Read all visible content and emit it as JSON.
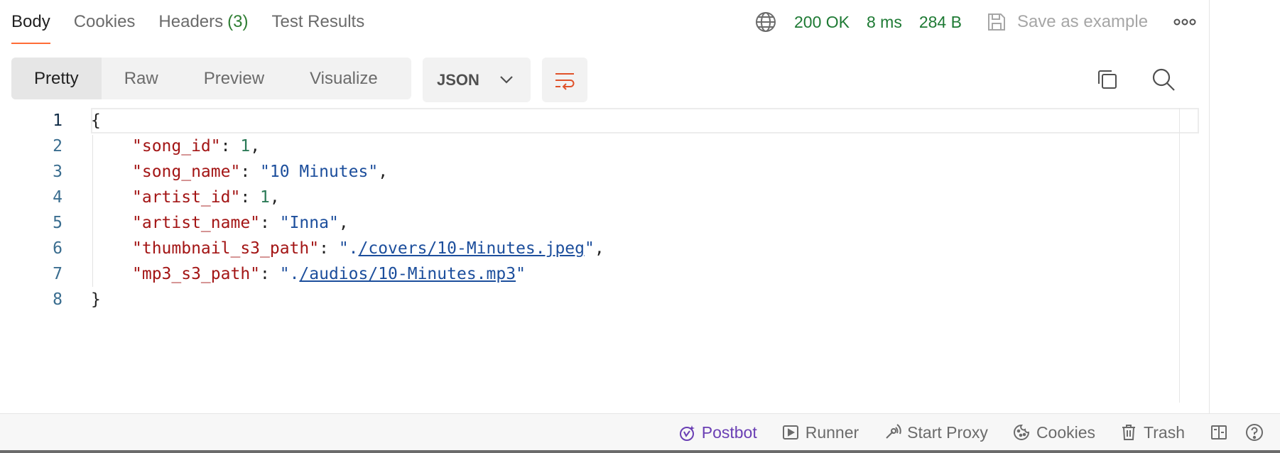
{
  "tabs": [
    {
      "label": "Body",
      "active": true
    },
    {
      "label": "Cookies",
      "active": false
    },
    {
      "label": "Headers",
      "count": "(3)",
      "active": false
    },
    {
      "label": "Test Results",
      "active": false
    }
  ],
  "status": {
    "code": "200 OK",
    "time": "8 ms",
    "size": "284 B",
    "save_label": "Save as example"
  },
  "view_modes": [
    {
      "label": "Pretty",
      "active": true
    },
    {
      "label": "Raw",
      "active": false
    },
    {
      "label": "Preview",
      "active": false
    },
    {
      "label": "Visualize",
      "active": false
    }
  ],
  "format": {
    "selected": "JSON"
  },
  "editor": {
    "line_numbers": [
      "1",
      "2",
      "3",
      "4",
      "5",
      "6",
      "7",
      "8"
    ],
    "open_brace": "{",
    "close_brace": "}",
    "fields": [
      {
        "key": "\"song_id\"",
        "value": "1",
        "type": "number",
        "comma": ","
      },
      {
        "key": "\"song_name\"",
        "value": "\"10 Minutes\"",
        "type": "string",
        "comma": ","
      },
      {
        "key": "\"artist_id\"",
        "value": "1",
        "type": "number",
        "comma": ","
      },
      {
        "key": "\"artist_name\"",
        "value": "\"Inna\"",
        "type": "string",
        "comma": ","
      },
      {
        "key": "\"thumbnail_s3_path\"",
        "value_prefix": "\".",
        "link": "/covers/10-Minutes.jpeg",
        "value_suffix": "\"",
        "type": "link",
        "comma": ","
      },
      {
        "key": "\"mp3_s3_path\"",
        "value_prefix": "\".",
        "link": "/audios/10-Minutes.mp3",
        "value_suffix": "\"",
        "type": "link",
        "comma": ""
      }
    ]
  },
  "footer": {
    "postbot": "Postbot",
    "runner": "Runner",
    "start_proxy": "Start Proxy",
    "cookies": "Cookies",
    "trash": "Trash"
  },
  "colors": {
    "accent": "#ff6c37",
    "status_ok": "#1e7a34",
    "postbot": "#6a3fb4"
  }
}
